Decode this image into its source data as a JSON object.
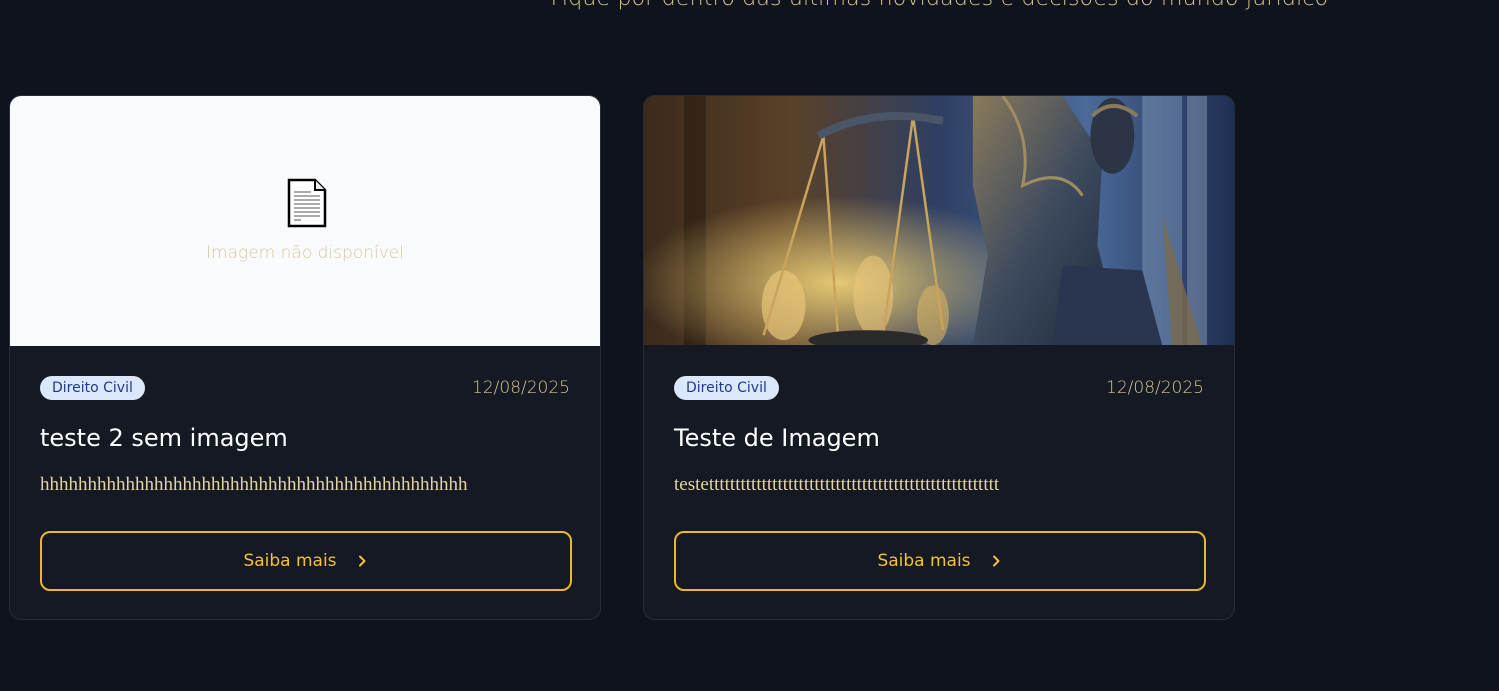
{
  "header": {
    "subtitle": "Fique por dentro das últimas novidades e decisões do mundo jurídico"
  },
  "cards": [
    {
      "image_available": false,
      "placeholder_icon": "document-icon",
      "placeholder_text": "Imagem não disponível",
      "category": "Direito Civil",
      "date": "12/08/2025",
      "title": "teste 2 sem imagem",
      "excerpt": "hhhhhhhhhhhhhhhhhhhhhhhhhhhhhhhhhhhhhhhhhhhhh",
      "cta_label": "Saiba mais",
      "cta_icon": "chevron-right-icon"
    },
    {
      "image_available": true,
      "image_subject": "lady-justice-statue-photo",
      "category": "Direito Civil",
      "date": "12/08/2025",
      "title": "Teste de Imagem",
      "excerpt": "testettttttttttttttttttttttttttttttttttttttttttttttttttttttt",
      "cta_label": "Saiba mais",
      "cta_icon": "chevron-right-icon"
    }
  ],
  "colors": {
    "background": "#0e131d",
    "card": "#141923",
    "accent": "#eab72f",
    "badge_bg": "#dbe7fb",
    "badge_text": "#1e3a8a"
  }
}
